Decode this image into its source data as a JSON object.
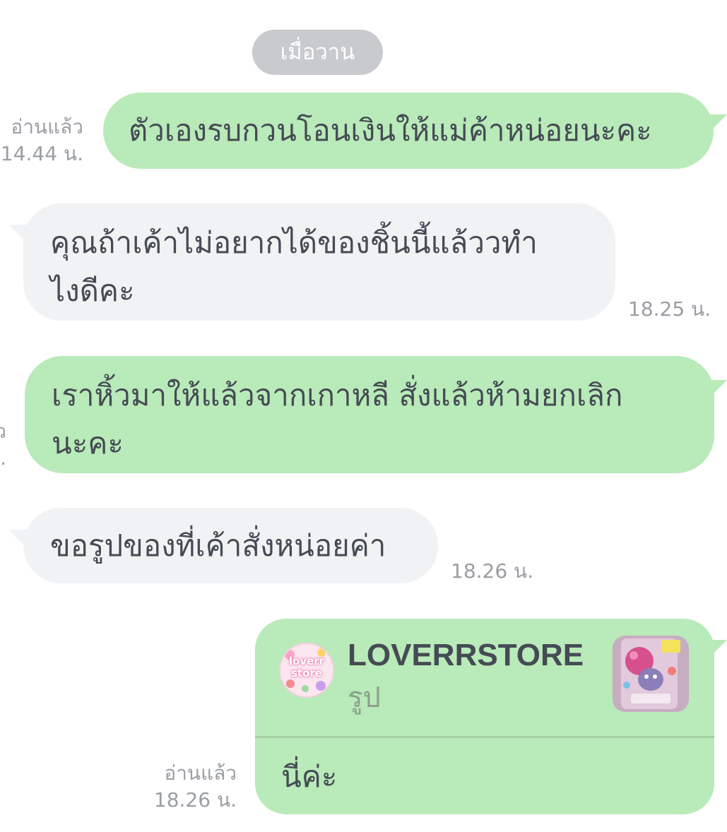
{
  "date_separator": "เมื่อวาน",
  "colors": {
    "outgoing_bubble": "#b9eab9",
    "incoming_bubble": "#f1f2f4",
    "date_pill": "#c9cacd",
    "meta_text": "#9a9ea4",
    "message_text": "#454b54"
  },
  "messages": [
    {
      "direction": "outgoing",
      "lines": [
        "ตัวเองรบกวนโอนเงินให้แม่ค้าหน่อยนะคะ"
      ],
      "read_label": "อ่านแล้ว",
      "time": "14.44 น."
    },
    {
      "direction": "incoming",
      "lines": [
        "คุณถ้าเค้าไม่อยากได้ของชิ้นนี้แล้ววทำ",
        "ไงดีคะ"
      ],
      "time": "18.25 น."
    },
    {
      "direction": "outgoing",
      "lines": [
        "เราหิ้วมาให้แล้วจากเกาหลี สั่งแล้วห้ามยกเลิก",
        "นะคะ"
      ],
      "read_label_fragment": "ว",
      "time_fragment": "."
    },
    {
      "direction": "incoming",
      "lines": [
        "ขอรูปของที่เค้าสั่งหน่อยค่า"
      ],
      "time": "18.26 น."
    },
    {
      "direction": "outgoing",
      "type": "shared_item_card",
      "card": {
        "logo_icon": "loverrstore-logo",
        "logo_text": "loverr store",
        "title": "LOVERRSTORE",
        "subtitle": "รูป",
        "thumbnail_icon": "product-photo-thumbnail"
      },
      "text": "นี่ค่ะ",
      "read_label": "อ่านแล้ว",
      "time": "18.26 น."
    }
  ]
}
